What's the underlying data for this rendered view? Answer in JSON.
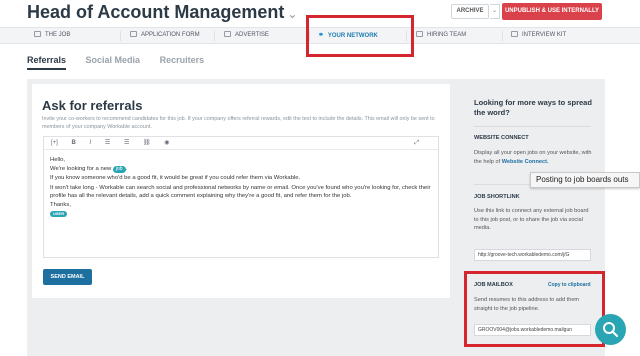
{
  "header": {
    "title": "Head of Account Management",
    "archive_label": "ARCHIVE",
    "unpublish_label": "UNPUBLISH & USE INTERNALLY"
  },
  "topnav": {
    "tabs": [
      {
        "label": "THE JOB",
        "icon": "briefcase-icon"
      },
      {
        "label": "APPLICATION FORM",
        "icon": "edit-icon"
      },
      {
        "label": "ADVERTISE",
        "icon": "megaphone-icon"
      },
      {
        "label": "YOUR NETWORK",
        "icon": "network-icon"
      },
      {
        "label": "HIRING TEAM",
        "icon": "team-icon"
      },
      {
        "label": "INTERVIEW KIT",
        "icon": "document-icon"
      }
    ]
  },
  "subtabs": [
    "Referrals",
    "Social Media",
    "Recruiters"
  ],
  "referrals": {
    "heading": "Ask for referrals",
    "description": "Invite your co-workers to recommend candidates for this job. If your company offers referral rewards, edit the text to include the details. This email will only be sent to members of your company Workable account.",
    "toolbar": [
      "[+]",
      "B",
      "I",
      "☰",
      "☰",
      "🔗",
      "👁"
    ],
    "email": {
      "greeting": "Hello,",
      "line1": "We're looking for a new",
      "job_tag": "job",
      "line2": "If you know someone who'd be a good fit, it would be great if you could refer them via Workable.",
      "line3": "It won't take long - Workable can search social and professional networks by name or email. Once you've found who you're looking for, check their profile has all the relevant details, add a quick comment explaining why they're a good fit, and refer them for the job.",
      "closing": "Thanks,",
      "user_tag": "USER"
    },
    "send_label": "SEND EMAIL"
  },
  "side": {
    "heading": "Looking for more ways to spread the word?",
    "website_connect_label": "WEBSITE CONNECT",
    "website_connect_text_pre": "Display all your open jobs on your website, with the help of",
    "website_connect_link": "Website Connect.",
    "shortlink_label": "JOB SHORTLINK",
    "shortlink_text": "Use this link to connect any external job board to this job post, or to share the job via social media.",
    "shortlink_value": "http://groove-tech.workabledemo.com/j/G",
    "mailbox_label": "JOB MAILBOX",
    "copy_label": "Copy to clipboard",
    "mailbox_text": "Send resumes to this address to add them straight to the job pipeline.",
    "mailbox_value": "GROOV004@jobs.workabledemo.mailgun"
  },
  "tooltip": "Posting to job boards outs"
}
